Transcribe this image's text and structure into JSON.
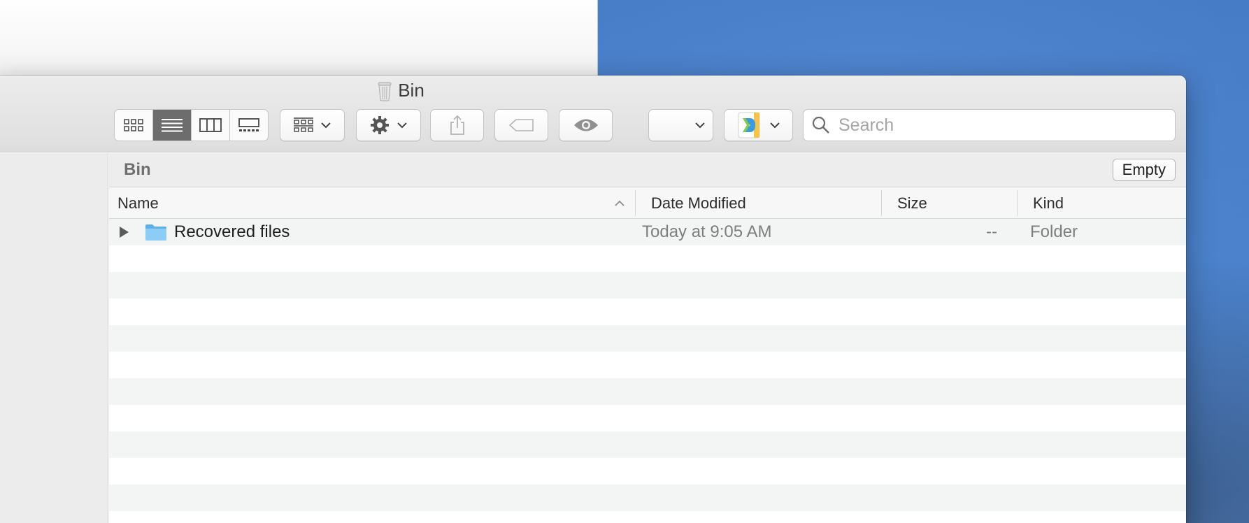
{
  "window": {
    "title": "Bin"
  },
  "toolbar": {
    "view_modes": [
      "icon-view",
      "list-view",
      "column-view",
      "gallery-view"
    ],
    "active_view": "list-view",
    "search_placeholder": "Search"
  },
  "path_bar": {
    "location": "Bin",
    "empty_label": "Empty"
  },
  "columns": {
    "name": "Name",
    "date_modified": "Date Modified",
    "size": "Size",
    "kind": "Kind"
  },
  "files": [
    {
      "name": "Recovered files",
      "date_modified": "Today at 9:05 AM",
      "size": "--",
      "kind": "Folder",
      "icon": "folder-icon"
    }
  ],
  "colors": {
    "active_segment": "#6d6d6d",
    "folder_blue": "#6fbdf2",
    "desktop_blue": "#4a7fc4"
  }
}
